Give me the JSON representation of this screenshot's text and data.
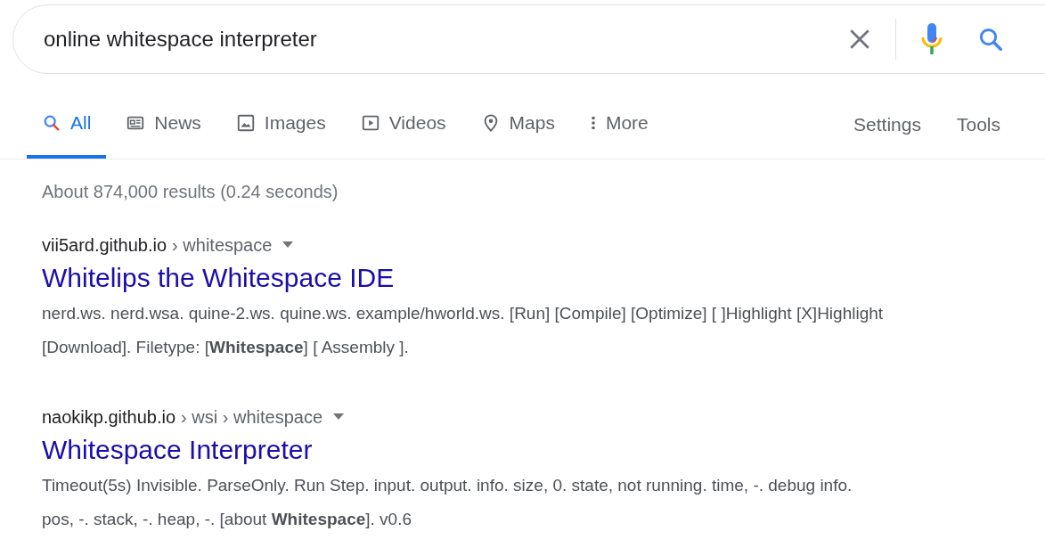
{
  "search": {
    "value": "online whitespace interpreter"
  },
  "tabs": [
    {
      "label": "All",
      "kind": "search",
      "selected": true
    },
    {
      "label": "News",
      "kind": "news",
      "selected": false
    },
    {
      "label": "Images",
      "kind": "image",
      "selected": false
    },
    {
      "label": "Videos",
      "kind": "video",
      "selected": false
    },
    {
      "label": "Maps",
      "kind": "pin",
      "selected": false
    },
    {
      "label": "More",
      "kind": "dots",
      "selected": false
    }
  ],
  "tools": [
    "Settings",
    "Tools"
  ],
  "stats": "About 874,000 results (0.24 seconds)",
  "results": [
    {
      "domain": "vii5ard.github.io",
      "path": [
        "› whitespace"
      ],
      "title": "Whitelips the Whitespace IDE",
      "snippet": "nerd.ws. nerd.wsa. quine-2.ws. quine.ws. example/hworld.ws. [Run] [Compile] [Optimize] [ ]Highlight [X]Highlight [Download]. Filetype: [**Whitespace**] [ Assembly ]."
    },
    {
      "domain": "naokikp.github.io",
      "path": [
        "› wsi › whitespace"
      ],
      "title": "Whitespace Interpreter",
      "snippet": "Timeout(5s) Invisible. ParseOnly. Run Step. input. output. info. size, 0. state, not running. time, -. debug info. pos, -. stack, -. heap, -. [about **Whitespace**]. v0.6"
    }
  ]
}
